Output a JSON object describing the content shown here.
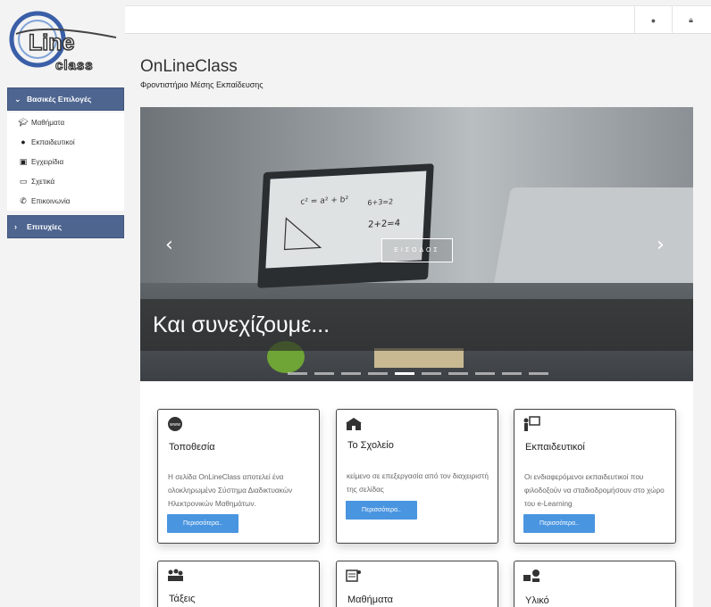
{
  "brand": {
    "logo_top": "Line",
    "logo_bottom": "class",
    "title": "OnLineClass",
    "subtitle": "Φροντιστήριο Μέσης Εκπαίδευσης"
  },
  "sidebar": {
    "section_main": "Βασικές Επιλογές",
    "items": [
      {
        "label": "Μαθήματα",
        "icon": "graduation-cap-icon"
      },
      {
        "label": "Εκπαιδευτικοί",
        "icon": "user-icon"
      },
      {
        "label": "Εγχειρίδια",
        "icon": "book-icon"
      },
      {
        "label": "Σχετικά",
        "icon": "credit-card-icon"
      },
      {
        "label": "Επικοινωνία",
        "icon": "phone-icon"
      }
    ],
    "section_second": "Επιτυχίες"
  },
  "topbar": {
    "language_icon": "globe-icon",
    "login_icon": "lock-icon"
  },
  "hero": {
    "login_label": "ΕΙΣΟΔΟΣ",
    "caption": "Και συνεχίζουμε...",
    "whiteboard_formula": "c² = a² + b²",
    "whiteboard_formula2": "6+3=2",
    "whiteboard_formula3": "2+2=4",
    "slide_count": 10,
    "active_slide": 5
  },
  "cards": [
    {
      "title": "Τοποθεσία",
      "text": "Η σελίδα OnLineClass αποτελεί ένα ολοκληρωμένο Σύστημα Διαδικτυακών Ηλεκτρονικών Μαθημάτων.",
      "button": "Περισσότερα..",
      "icon": "www-globe-icon"
    },
    {
      "title": "Το Σχολείο",
      "text": "κείμενο σε επεξεργασία από τον διαχειριστή της σελίδας",
      "button": "Περισσότερα..",
      "icon": "school-building-icon"
    },
    {
      "title": "Εκπαιδευτικοί",
      "text": "Οι ενδιαφερόμενοι εκπαιδευτικοί που φιλοδοξούν να σταδιοδρομήσουν στο χώρο του e-Learning",
      "button": "Περισσότερα..",
      "icon": "teacher-board-icon"
    },
    {
      "title": "Τάξεις",
      "icon": "classroom-icon"
    },
    {
      "title": "Μαθήματα",
      "icon": "lesson-list-icon"
    },
    {
      "title": "Υλικό",
      "icon": "materials-icon"
    }
  ]
}
